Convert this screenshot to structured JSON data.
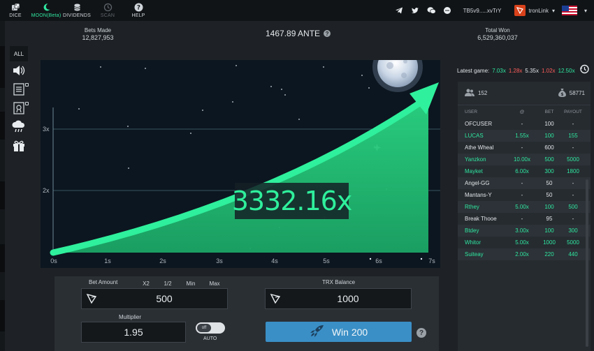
{
  "nav": {
    "items": [
      {
        "label": "DICE",
        "icon": "dice-icon",
        "state": "normal"
      },
      {
        "label": "MOON(Beta)",
        "icon": "moon-icon",
        "state": "active"
      },
      {
        "label": "DIVIDENDS",
        "icon": "coins-icon",
        "state": "normal"
      },
      {
        "label": "SCAN",
        "icon": "clock-icon",
        "state": "dim"
      },
      {
        "label": "HELP",
        "icon": "question-icon",
        "state": "normal"
      }
    ],
    "address": "TB5v9.....xvTrY",
    "wallet": "tronLink"
  },
  "stats": {
    "bets_made_label": "Bets Made",
    "bets_made": "12,827,953",
    "ante": "1467.89 ANTE",
    "total_won_label": "Total Won",
    "total_won": "6,529,360,037"
  },
  "sidebar": {
    "all_label": "ALL"
  },
  "game": {
    "multiplier": "3332.16x",
    "y_ticks": [
      "3x",
      "2x"
    ],
    "x_ticks": [
      "0s",
      "1s",
      "2s",
      "3s",
      "4s",
      "5s",
      "6s",
      "7s"
    ]
  },
  "latest": {
    "label": "Latest game:",
    "values": [
      {
        "text": "7.03x",
        "color": "g"
      },
      {
        "text": "1.28x",
        "color": "r"
      },
      {
        "text": "5.35x",
        "color": "w"
      },
      {
        "text": "1.02x",
        "color": "r"
      },
      {
        "text": "12.50x",
        "color": "g"
      }
    ]
  },
  "players": {
    "count": "152",
    "pot": "58771",
    "headers": [
      "USER",
      "@",
      "BET",
      "PAYOUT"
    ],
    "rows": [
      {
        "user": "OFCUSER",
        "at": "-",
        "bet": "100",
        "payout": "-",
        "color": "w"
      },
      {
        "user": "LUCAS",
        "at": "1.55x",
        "bet": "100",
        "payout": "155",
        "color": "g"
      },
      {
        "user": "Athe  Wheal",
        "at": "-",
        "bet": "600",
        "payout": "-",
        "color": "w"
      },
      {
        "user": "Yanzkon",
        "at": "10.00x",
        "bet": "500",
        "payout": "5000",
        "color": "g"
      },
      {
        "user": "Mayket",
        "at": "6.00x",
        "bet": "300",
        "payout": "1800",
        "color": "g"
      },
      {
        "user": "Angel-GG",
        "at": "-",
        "bet": "50",
        "payout": "-",
        "color": "w"
      },
      {
        "user": "Mantans-Y",
        "at": "-",
        "bet": "50",
        "payout": "-",
        "color": "w"
      },
      {
        "user": "Rthey",
        "at": "5.00x",
        "bet": "100",
        "payout": "500",
        "color": "g"
      },
      {
        "user": "Break  Thooe",
        "at": "-",
        "bet": "95",
        "payout": "-",
        "color": "w"
      },
      {
        "user": "Btdey",
        "at": "3.00x",
        "bet": "100",
        "payout": "300",
        "color": "g"
      },
      {
        "user": "Whitor",
        "at": "5.00x",
        "bet": "1000",
        "payout": "5000",
        "color": "g"
      },
      {
        "user": "Suiteay",
        "at": "2.00x",
        "bet": "220",
        "payout": "440",
        "color": "g"
      }
    ]
  },
  "bet": {
    "amount_label": "Bet Amount",
    "x2": "X2",
    "half": "1/2",
    "min": "Min",
    "max": "Max",
    "amount": "500",
    "balance_label": "TRX Balance",
    "balance": "1000",
    "multiplier_label": "Multiplier",
    "multiplier": "1.95",
    "toggle": "off",
    "auto": "AUTO",
    "win_label": "Win 200"
  }
}
